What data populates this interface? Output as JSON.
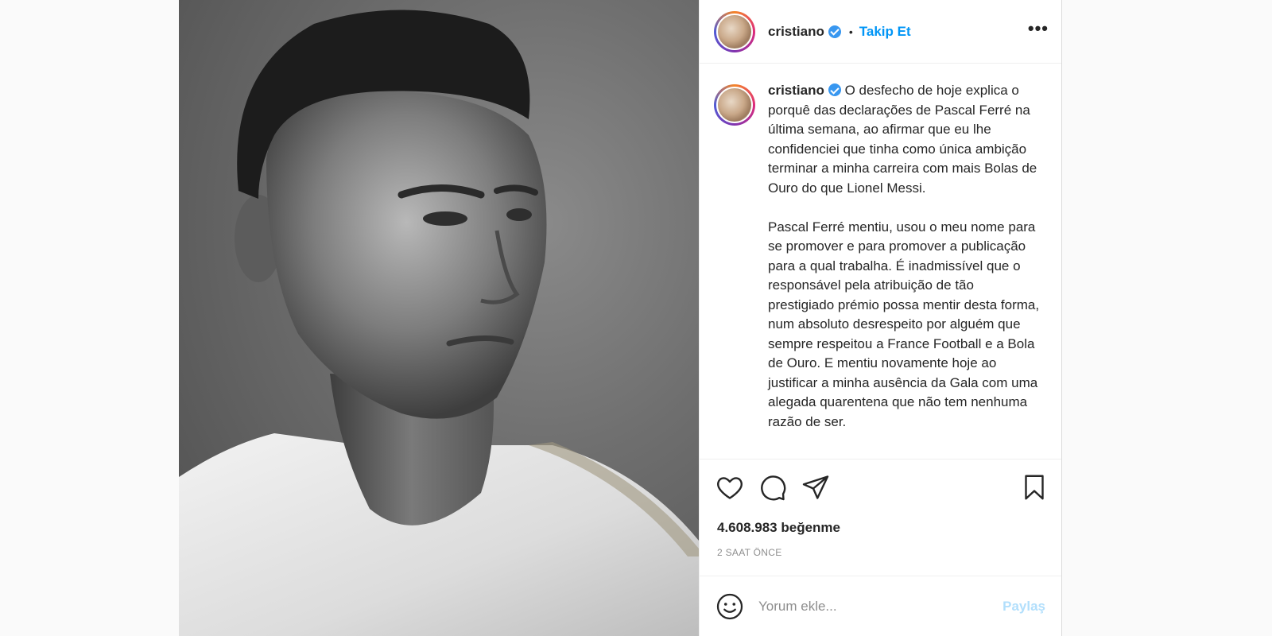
{
  "post": {
    "username": "cristiano",
    "follow_label": "Takip Et",
    "separator": "•",
    "more_label": "•••",
    "caption": "O desfecho de hoje explica o porquê das declarações de Pascal Ferré na última semana, ao afirmar que eu lhe confidenciei que tinha como única ambição terminar a minha carreira com mais Bolas de Ouro do que Lionel Messi.\n\nPascal Ferré mentiu, usou o meu nome para se promover e para promover a publicação para a qual trabalha. É inadmissível que o responsável pela atribuição de tão prestigiado prémio possa mentir desta forma, num absoluto desrespeito por alguém que sempre respeitou a France Football e a Bola de Ouro. E mentiu novamente hoje ao justificar a minha ausência da Gala com uma alegada quarentena que não tem nenhuma razão de ser.",
    "likes": "4.608.983 beğenme",
    "time": "2 SAAT ÖNCE"
  },
  "comment": {
    "placeholder": "Yorum ekle...",
    "share_label": "Paylaş"
  },
  "icons": {
    "like": "heart-icon",
    "comment": "comment-bubble-icon",
    "share": "paper-plane-icon",
    "save": "bookmark-icon",
    "emoji": "smiley-icon",
    "verified": "verified-badge-icon"
  },
  "colors": {
    "link_blue": "#0095f6",
    "verified_blue": "#3897f0",
    "share_disabled": "#b2dffc",
    "muted": "#8e8e8e"
  }
}
